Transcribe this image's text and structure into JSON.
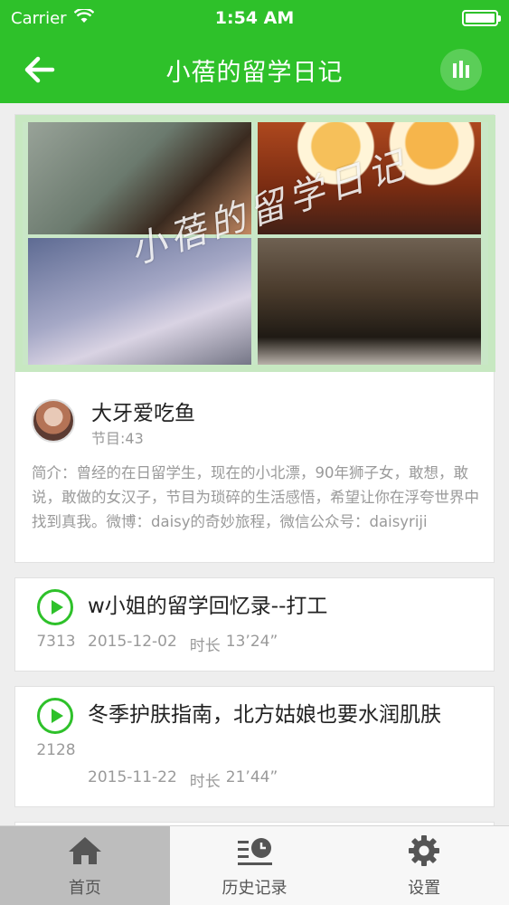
{
  "status_bar": {
    "carrier": "Carrier",
    "time": "1:54 AM"
  },
  "nav": {
    "title": "小蓓的留学日记",
    "back_icon": "back-arrow-icon",
    "stats_icon": "bar-chart-icon"
  },
  "profile": {
    "cover_overlay_text": "小蓓的留学日记",
    "author_name": "大牙爱吃鱼",
    "episode_count": "节目:43",
    "intro": "简介：曾经的在日留学生，现在的小北漂，90年狮子女，敢想，敢说，敢做的女汉子，节目为琐碎的生活感悟，希望让你在浮夸世界中找到真我。微博：daisy的奇妙旅程，微信公众号：daisyriji"
  },
  "episodes": [
    {
      "title": "w小姐的留学回忆录--打工",
      "plays": "7313",
      "date": "2015-12-02",
      "duration_label": "时长",
      "duration": "13’24”"
    },
    {
      "title": "冬季护肤指南，北方姑娘也要水润肌肤",
      "plays": "2128",
      "date": "2015-11-22",
      "duration_label": "时长",
      "duration": "21’44”"
    }
  ],
  "tabs": [
    {
      "label": "首页",
      "icon": "home-icon",
      "active": true
    },
    {
      "label": "历史记录",
      "icon": "history-icon",
      "active": false
    },
    {
      "label": "设置",
      "icon": "gear-icon",
      "active": false
    }
  ],
  "colors": {
    "brand_green": "#2ec12a",
    "muted_text": "#9a9a9a"
  }
}
